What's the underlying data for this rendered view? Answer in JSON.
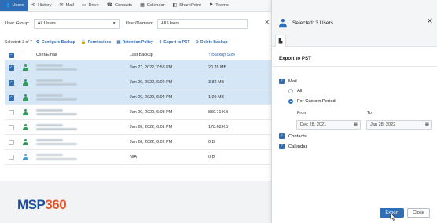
{
  "tabs": [
    {
      "icon": "users-icon",
      "glyph": "👥",
      "label": "Users",
      "active": true
    },
    {
      "icon": "history-icon",
      "glyph": "⟲",
      "label": "History",
      "active": false
    },
    {
      "icon": "mail-icon",
      "glyph": "✉",
      "label": "Mail",
      "active": false
    },
    {
      "icon": "drive-icon",
      "glyph": "▭",
      "label": "Drive",
      "active": false
    },
    {
      "icon": "contacts-icon",
      "glyph": "☎",
      "label": "Contacts",
      "active": false
    },
    {
      "icon": "calendar-icon",
      "glyph": "▦",
      "label": "Calendar",
      "active": false
    },
    {
      "icon": "sharepoint-icon",
      "glyph": "◧",
      "label": "SharePoint",
      "active": false
    },
    {
      "icon": "teams-icon",
      "glyph": "⚑",
      "label": "Teams",
      "active": false
    }
  ],
  "filters": {
    "group_label": "User Group:",
    "group_value": "All Users",
    "domain_label": "User/Domain:",
    "domain_value": "All Users"
  },
  "actions": {
    "selected": "Selected: 3 of 7",
    "items": [
      {
        "icon": "gear-icon",
        "glyph": "⚙",
        "label": "Configure Backup"
      },
      {
        "icon": "lock-icon",
        "glyph": "🔒",
        "label": "Permissions"
      },
      {
        "icon": "policy-icon",
        "glyph": "▤",
        "label": "Retention Policy"
      },
      {
        "icon": "export-icon",
        "glyph": "⇪",
        "label": "Export to PST"
      },
      {
        "icon": "delete-icon",
        "glyph": "⊖",
        "label": "Delete Backup"
      }
    ]
  },
  "table": {
    "headers": {
      "user": "User/Email",
      "last_backup": "Last Backup",
      "size": "Backup Size",
      "size_sort": "↑"
    },
    "rows": [
      {
        "selected": true,
        "icon_color": "#2e9d5a",
        "last_backup": "Jan 27, 2022, 7:58 PM",
        "size": "20.78 MB"
      },
      {
        "selected": true,
        "icon_color": "#2e9d5a",
        "last_backup": "Jan 26, 2022, 6:02 PM",
        "size": "3.82 MB"
      },
      {
        "selected": true,
        "icon_color": "#2e9d5a",
        "last_backup": "Jan 26, 2022, 6:04 PM",
        "size": "1.99 MB"
      },
      {
        "selected": false,
        "icon_color": "#2e9d5a",
        "last_backup": "Jan 26, 2022, 6:03 PM",
        "size": "830.71 KB"
      },
      {
        "selected": false,
        "icon_color": "#2e9d5a",
        "last_backup": "Jan 26, 2022, 6:01 PM",
        "size": "178.68 KB"
      },
      {
        "selected": false,
        "icon_color": "#2e9d5a",
        "last_backup": "Jan 26, 2022, 6:02 PM",
        "size": "0 B"
      },
      {
        "selected": false,
        "icon_color": "#3a9bd5",
        "last_backup": "N/A",
        "size": "0 B"
      }
    ]
  },
  "logo": {
    "part1": "MSP",
    "part2": "360"
  },
  "panel": {
    "title": "Selected: 3 Users",
    "close": "✕",
    "section": "Export to PST",
    "mail_label": "Mail",
    "all_label": "All",
    "custom_label": "For Custom Period",
    "from_label": "From",
    "to_label": "To",
    "from_date": "Dec 28, 2021",
    "to_date": "Jan 28, 2022",
    "contacts_label": "Contacts",
    "calendar_label": "Calendar",
    "export_button": "Export",
    "close_button": "Close"
  },
  "colors": {
    "accent": "#2f6db5",
    "selected_row": "#d5e7f6",
    "user_icon": "#2e9d5a",
    "user_icon_alt": "#3a9bd5"
  }
}
